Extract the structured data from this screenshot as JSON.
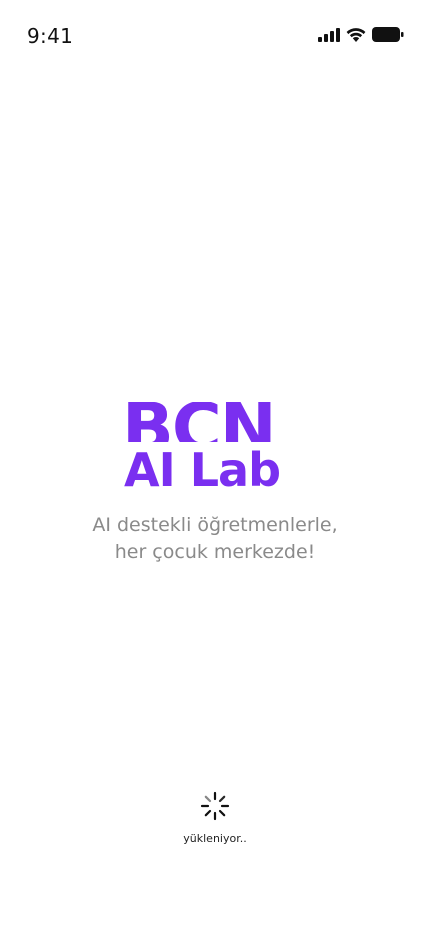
{
  "status_bar": {
    "time": "9:41",
    "icons": [
      "cellular-signal-icon",
      "wifi-icon",
      "battery-icon"
    ]
  },
  "logo": {
    "top_text": "BCN",
    "bottom_text": "AI Lab",
    "color": "#7a2ff0"
  },
  "tagline": {
    "line1": "AI destekli öğretmenlerle,",
    "line2": "her çocuk merkezde!"
  },
  "loader": {
    "icon": "spinner-icon",
    "text": "yükleniyor.."
  }
}
